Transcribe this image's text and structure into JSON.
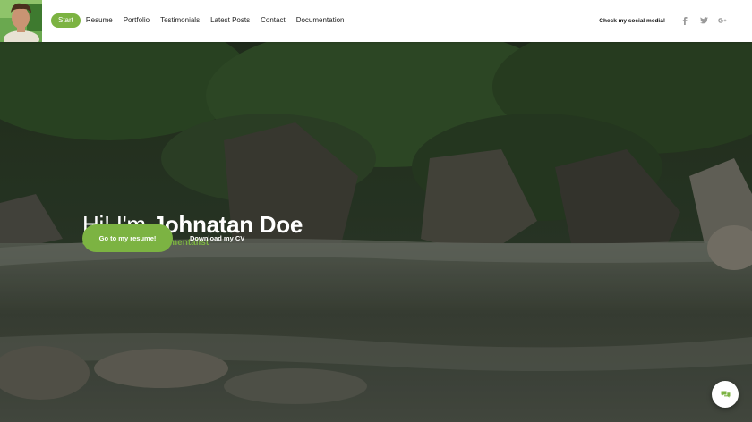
{
  "header": {
    "nav": [
      {
        "label": "Start",
        "active": true
      },
      {
        "label": "Resume"
      },
      {
        "label": "Portfolio"
      },
      {
        "label": "Testimonials"
      },
      {
        "label": "Latest Posts"
      },
      {
        "label": "Contact"
      },
      {
        "label": "Documentation"
      }
    ],
    "social_label": "Check my social media!",
    "social_icons": [
      "facebook-icon",
      "twitter-icon",
      "google-plus-icon"
    ]
  },
  "hero": {
    "greeting": "Hi! I'm",
    "name": "Johnatan Doe",
    "subtitle": "experienced environmentalist",
    "primary_button": "Go to my resume!",
    "secondary_button": "Download my CV"
  },
  "colors": {
    "accent": "#7cb342",
    "header_bg": "#ffffff"
  }
}
